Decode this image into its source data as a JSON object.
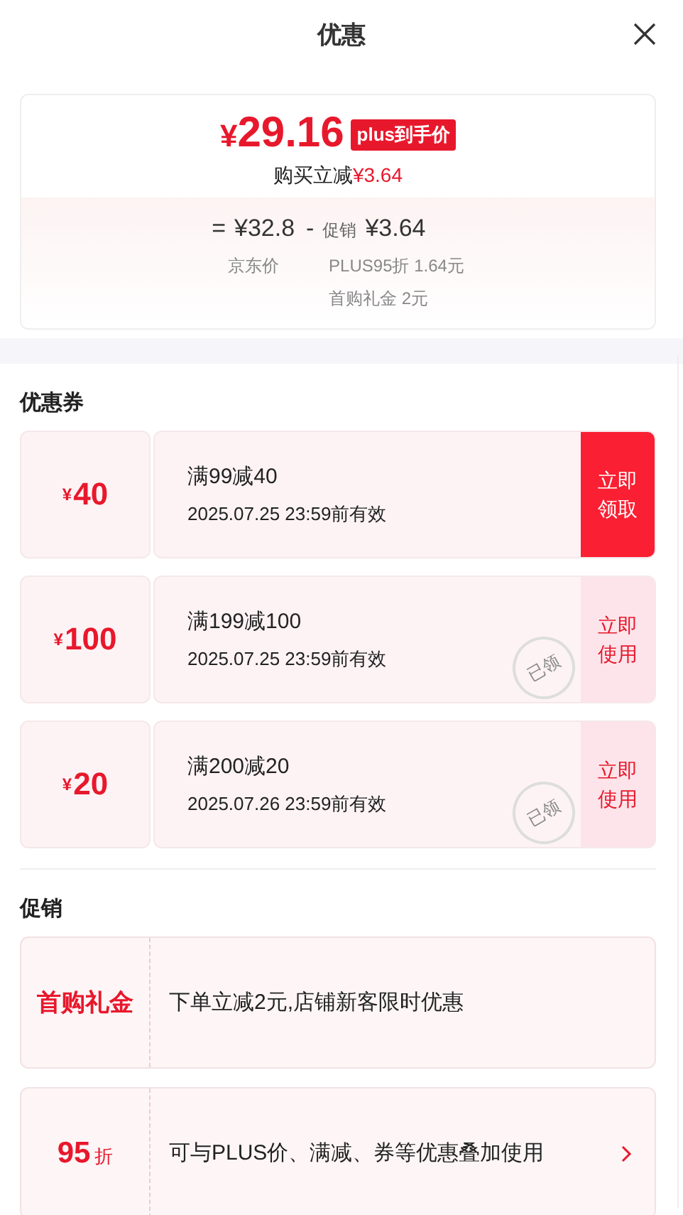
{
  "header": {
    "title": "优惠"
  },
  "price_card": {
    "currency": "¥",
    "price": "29.16",
    "badge": "plus到手价",
    "saving_label": "购买立减",
    "saving_amount": "¥3.64",
    "breakdown": {
      "equals": "=",
      "base_price": "¥32.8",
      "minus": "-",
      "promo_label": "促销",
      "promo_amount": "¥3.64",
      "base_label": "京东价",
      "promo_details": [
        "PLUS95折 1.64元",
        "首购礼金 2元"
      ]
    }
  },
  "coupons": {
    "title": "优惠券",
    "items": [
      {
        "currency": "¥",
        "amount": "40",
        "condition": "满99减40",
        "validity": "2025.07.25 23:59前有效",
        "action": "立即领取",
        "claimed": false
      },
      {
        "currency": "¥",
        "amount": "100",
        "condition": "满199减100",
        "validity": "2025.07.25 23:59前有效",
        "action": "立即使用",
        "claimed": true,
        "stamp": "已领"
      },
      {
        "currency": "¥",
        "amount": "20",
        "condition": "满200减20",
        "validity": "2025.07.26 23:59前有效",
        "action": "立即使用",
        "claimed": true,
        "stamp": "已领"
      }
    ]
  },
  "promotions": {
    "title": "促销",
    "items": [
      {
        "kind": "label",
        "label": "首购礼金",
        "description": "下单立减2元,店铺新客限时优惠",
        "arrow": false
      },
      {
        "kind": "discount",
        "value": "95",
        "unit": "折",
        "description": "可与PLUS价、满减、券等优惠叠加使用",
        "arrow": true
      }
    ]
  }
}
